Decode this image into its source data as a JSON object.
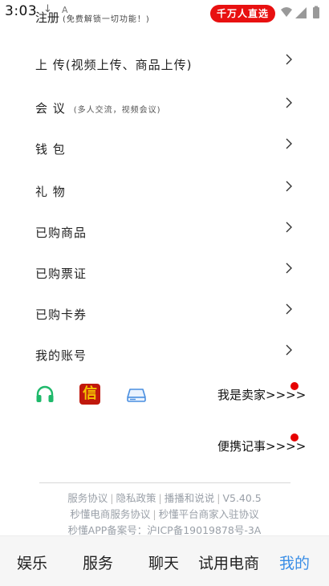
{
  "status_bar": {
    "time": "3:03",
    "download_glyph": "↓",
    "a_glyph": "A",
    "promo": "千万人直选"
  },
  "register": {
    "label": "注册",
    "note": "(免费解锁一切功能！)"
  },
  "menu": [
    {
      "label": "上  传(视频上传、商品上传)",
      "sub": ""
    },
    {
      "label": "会  议",
      "sub": "(多人交流，视频会议)"
    },
    {
      "label": "钱  包",
      "sub": ""
    },
    {
      "label": "礼  物",
      "sub": ""
    },
    {
      "label": "已购商品",
      "sub": ""
    },
    {
      "label": "已购票证",
      "sub": ""
    },
    {
      "label": "已购卡券",
      "sub": ""
    },
    {
      "label": "我的账号",
      "sub": ""
    }
  ],
  "icons": {
    "headset": "headset-icon",
    "letter": "信",
    "drive": "drive-icon"
  },
  "links": {
    "seller": "我是卖家>>>>",
    "notes": "便携记事>>>>"
  },
  "footer": {
    "service_agreement": "服务协议",
    "privacy_policy": "隐私政策",
    "broadcast_rules": "播播和说说",
    "version": "V5.40.5",
    "ecommerce_agreement": "秒懂电商服务协议",
    "merchant_agreement": "秒懂平台商家入驻协议",
    "icp": "秒懂APP备案号：沪ICP备19019878号-3A"
  },
  "tabs": [
    {
      "label": "娱乐",
      "active": false
    },
    {
      "label": "服务",
      "active": false
    },
    {
      "label": "聊天",
      "active": false
    },
    {
      "label": "试用电商",
      "active": false
    },
    {
      "label": "我的",
      "active": true
    }
  ],
  "colors": {
    "accent": "#3a8ee6",
    "promo_red": "#e81010",
    "notification_dot": "#e60000",
    "headset_green": "#1fb96b",
    "letter_bg": "#c0180d",
    "footer_text": "#9aa0a8"
  }
}
